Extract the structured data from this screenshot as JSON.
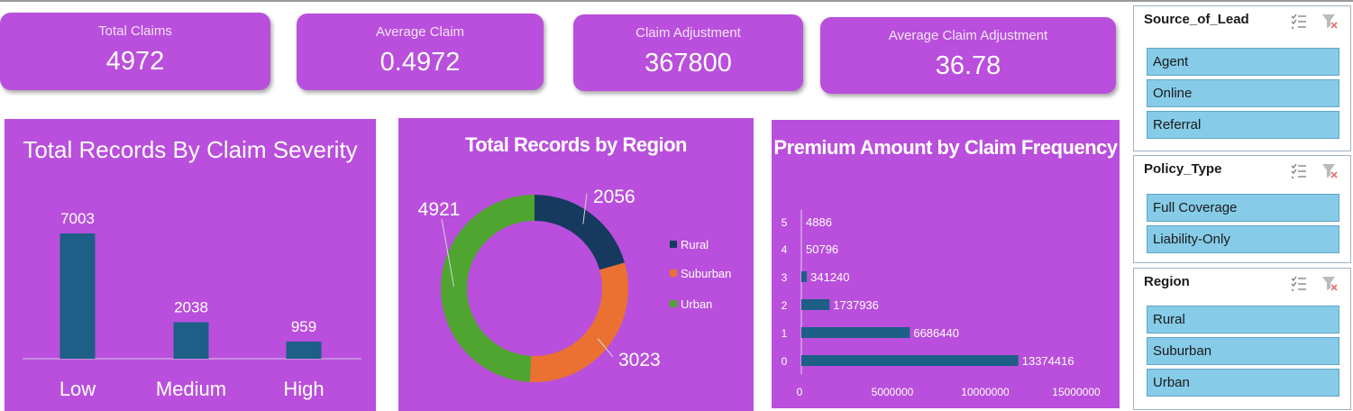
{
  "kpis": [
    {
      "label": "Total Claims",
      "value": "4972"
    },
    {
      "label": "Average Claim",
      "value": "0.4972"
    },
    {
      "label": "Claim Adjustment",
      "value": "367800"
    },
    {
      "label": "Average Claim Adjustment",
      "value": "36.78"
    }
  ],
  "colors": {
    "panel": "#b94fdc",
    "bar": "#1d5f86",
    "rural": "#163a5f",
    "suburban": "#ea7132",
    "urban": "#4fa530",
    "slicer_item": "#86cbe8"
  },
  "chart_data": [
    {
      "type": "bar",
      "title": "Total Records By Claim Severity",
      "categories": [
        "Low",
        "Medium",
        "High"
      ],
      "values": [
        7003,
        2038,
        959
      ],
      "ylim": [
        0,
        7003
      ]
    },
    {
      "type": "pie",
      "title": "Total Records by Region",
      "labels": [
        "Rural",
        "Suburban",
        "Urban"
      ],
      "values": [
        2056,
        3023,
        4921
      ],
      "legend": "right"
    },
    {
      "type": "bar",
      "orientation": "horizontal",
      "title": "Premium Amount by Claim Frequency",
      "categories": [
        "0",
        "1",
        "2",
        "3",
        "4",
        "5"
      ],
      "values": [
        13374416,
        6686440,
        1737936,
        341240,
        50796,
        4886
      ],
      "xticks": [
        "0",
        "5000000",
        "10000000",
        "15000000"
      ],
      "xlim": [
        0,
        15000000
      ]
    }
  ],
  "slicers": [
    {
      "title": "Source_of_Lead",
      "items": [
        "Agent",
        "Online",
        "Referral"
      ]
    },
    {
      "title": "Policy_Type",
      "items": [
        "Full Coverage",
        "Liability-Only"
      ]
    },
    {
      "title": "Region",
      "items": [
        "Rural",
        "Suburban",
        "Urban"
      ]
    }
  ],
  "icons": {
    "multi_select": "multi-select-icon",
    "clear_filter": "clear-filter-icon"
  }
}
